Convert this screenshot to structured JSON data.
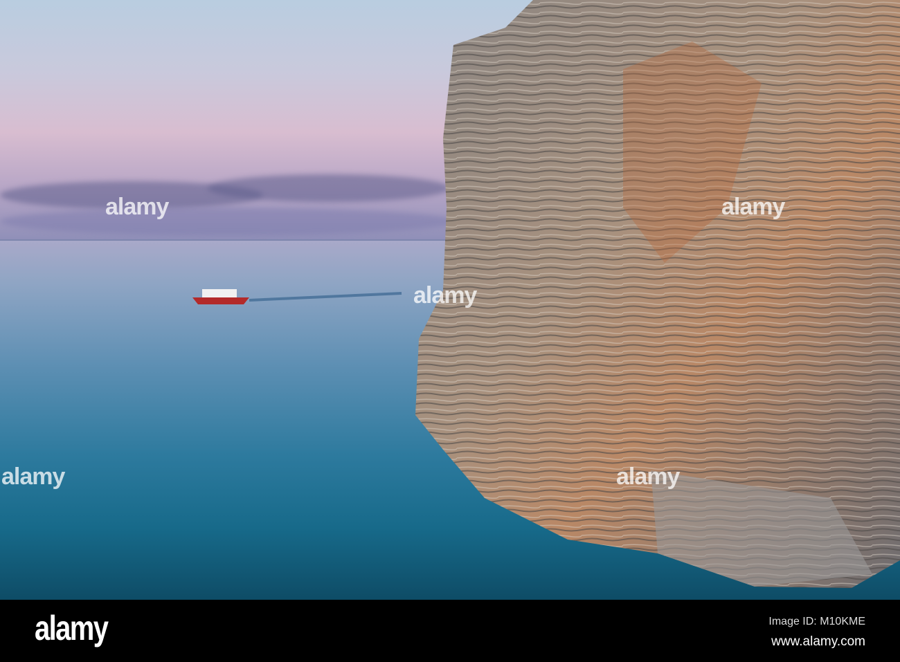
{
  "photo": {
    "description_alt": "Cliff by the sea with boat"
  },
  "watermark": {
    "text": "alamy"
  },
  "footer": {
    "logo": "alamy",
    "image_id": "Image ID: M10KME",
    "url": "www.alamy.com"
  },
  "colors": {
    "sky_top": "#b9cde0",
    "sea_deep": "#0e4c66",
    "rock": "#8a8580",
    "rust": "#b8663a"
  }
}
